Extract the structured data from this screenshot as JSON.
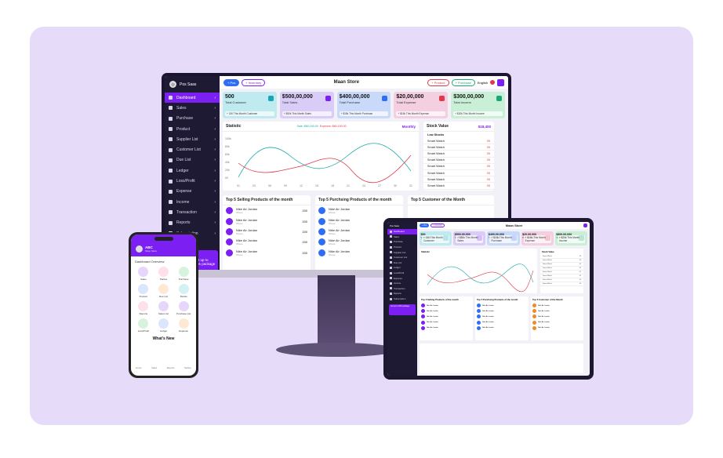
{
  "colors": {
    "accent": "#7c1ff2",
    "sidebar": "#1e1a33",
    "frame": "#e6dcfa"
  },
  "monitor": {
    "brand": "Pos Saas",
    "sidebar": [
      "Dashboard",
      "Sales",
      "Purchase",
      "Product",
      "Supplier List",
      "Customer List",
      "Due List",
      "Ledger",
      "Loss/Profit",
      "Expense",
      "Income",
      "Transaction",
      "Reports",
      "Subscription"
    ],
    "topbar": {
      "pos": "+ Pos",
      "inventory": "+ Inventory",
      "store": "Maan Store",
      "product": "+ Product",
      "purchase": "+ Purchase",
      "language": "English"
    },
    "cards": [
      {
        "value": "500",
        "label": "Total Customer",
        "foot": "+ 150 This Month Customer",
        "bg": "#bfeaf0",
        "icon": "#18a6b5"
      },
      {
        "value": "$500,00,000",
        "label": "Total Sales",
        "foot": "+ $50k This Month Sales",
        "bg": "#d9ccf7",
        "icon": "#7c1ff2"
      },
      {
        "value": "$400,00,000",
        "label": "Total Purchase",
        "foot": "+ $15k This Month Purchase",
        "bg": "#c8d9fa",
        "icon": "#2e6ef5"
      },
      {
        "value": "$20,00,000",
        "label": "Total Expense",
        "foot": "+ $15k This Month Expense",
        "bg": "#f4cfe0",
        "icon": "#e0394a"
      },
      {
        "value": "$300,00,000",
        "label": "Total Income",
        "foot": "+ $20k This Month Income",
        "bg": "#c9f0d6",
        "icon": "#1aa875"
      }
    ],
    "statistic": {
      "title": "Statistic",
      "sale": "Sale: $80,190.00",
      "expense": "Expense: $80,190.00",
      "range": "Monthly",
      "y": [
        "100k",
        "80k",
        "60k",
        "40k",
        "20k",
        "00"
      ],
      "x": [
        "01",
        "03",
        "06",
        "09",
        "12",
        "15",
        "18",
        "21",
        "24",
        "27",
        "30",
        "31"
      ]
    },
    "stock": {
      "title": "Stock Value",
      "value": "$18,400",
      "low": "Low Stocks",
      "items": [
        {
          "n": "Smart Watch",
          "q": "05"
        },
        {
          "n": "Smart Watch",
          "q": "05"
        },
        {
          "n": "Smart Watch",
          "q": "05"
        },
        {
          "n": "Smart Watch",
          "q": "05"
        },
        {
          "n": "Smart Watch",
          "q": "05"
        },
        {
          "n": "Smart Watch",
          "q": "05"
        },
        {
          "n": "Smart Watch",
          "q": "05"
        },
        {
          "n": "Smart Watch",
          "q": "05"
        }
      ]
    },
    "selling": {
      "title": "Top 5 Selling Products of the month",
      "rows": [
        {
          "n": "Nike Air Jordan",
          "s": "Shoes",
          "q": "150"
        },
        {
          "n": "Nike Air Jordan",
          "s": "Shoes",
          "q": "150"
        },
        {
          "n": "Nike Air Jordan",
          "s": "Shoes",
          "q": "150"
        },
        {
          "n": "Nike Air Jordan",
          "s": "Shoes",
          "q": "150"
        },
        {
          "n": "Nike Air Jordan",
          "s": "Shoes",
          "q": "150"
        }
      ]
    },
    "purchasing": {
      "title": "Top 5 Purchsing Products of the month",
      "rows": [
        {
          "n": "Nike Air Jordan",
          "s": "Shoes"
        },
        {
          "n": "Nike Air Jordan",
          "s": "Shoes"
        },
        {
          "n": "Nike Air Jordan",
          "s": "Shoes"
        },
        {
          "n": "Nike Air Jordan",
          "s": "Shoes"
        },
        {
          "n": "Nike Air Jordan",
          "s": "Shoes"
        }
      ]
    },
    "customers": {
      "title": "Top 5 Customer of the Month"
    },
    "promo": "Get up to 20% package"
  },
  "phone": {
    "user": "ABC",
    "role": "Shop Store",
    "overview": "Dashboard Overview",
    "items": [
      {
        "l": "Sales",
        "c": "#e6d6fb"
      },
      {
        "l": "Parties",
        "c": "#fde0ea"
      },
      {
        "l": "Purchase",
        "c": "#d7f3df"
      },
      {
        "l": "Product",
        "c": "#d9e6fd"
      },
      {
        "l": "Due List",
        "c": "#fde9d4"
      },
      {
        "l": "Stocks",
        "c": "#d4f1f3"
      },
      {
        "l": "Reports",
        "c": "#fde0ea"
      },
      {
        "l": "Sales List",
        "c": "#e6d6fb"
      },
      {
        "l": "Purchase List",
        "c": "#e6d6fb"
      },
      {
        "l": "Loss/Profit",
        "c": "#d7f3df"
      },
      {
        "l": "Ledger",
        "c": "#d9e6fd"
      },
      {
        "l": "Expense",
        "c": "#fde9d4"
      }
    ],
    "whatsnew": "What's New",
    "nav": [
      "Home",
      "Sales",
      "Reports",
      "Setting"
    ]
  },
  "tablet": {
    "store": "Maan Store"
  }
}
